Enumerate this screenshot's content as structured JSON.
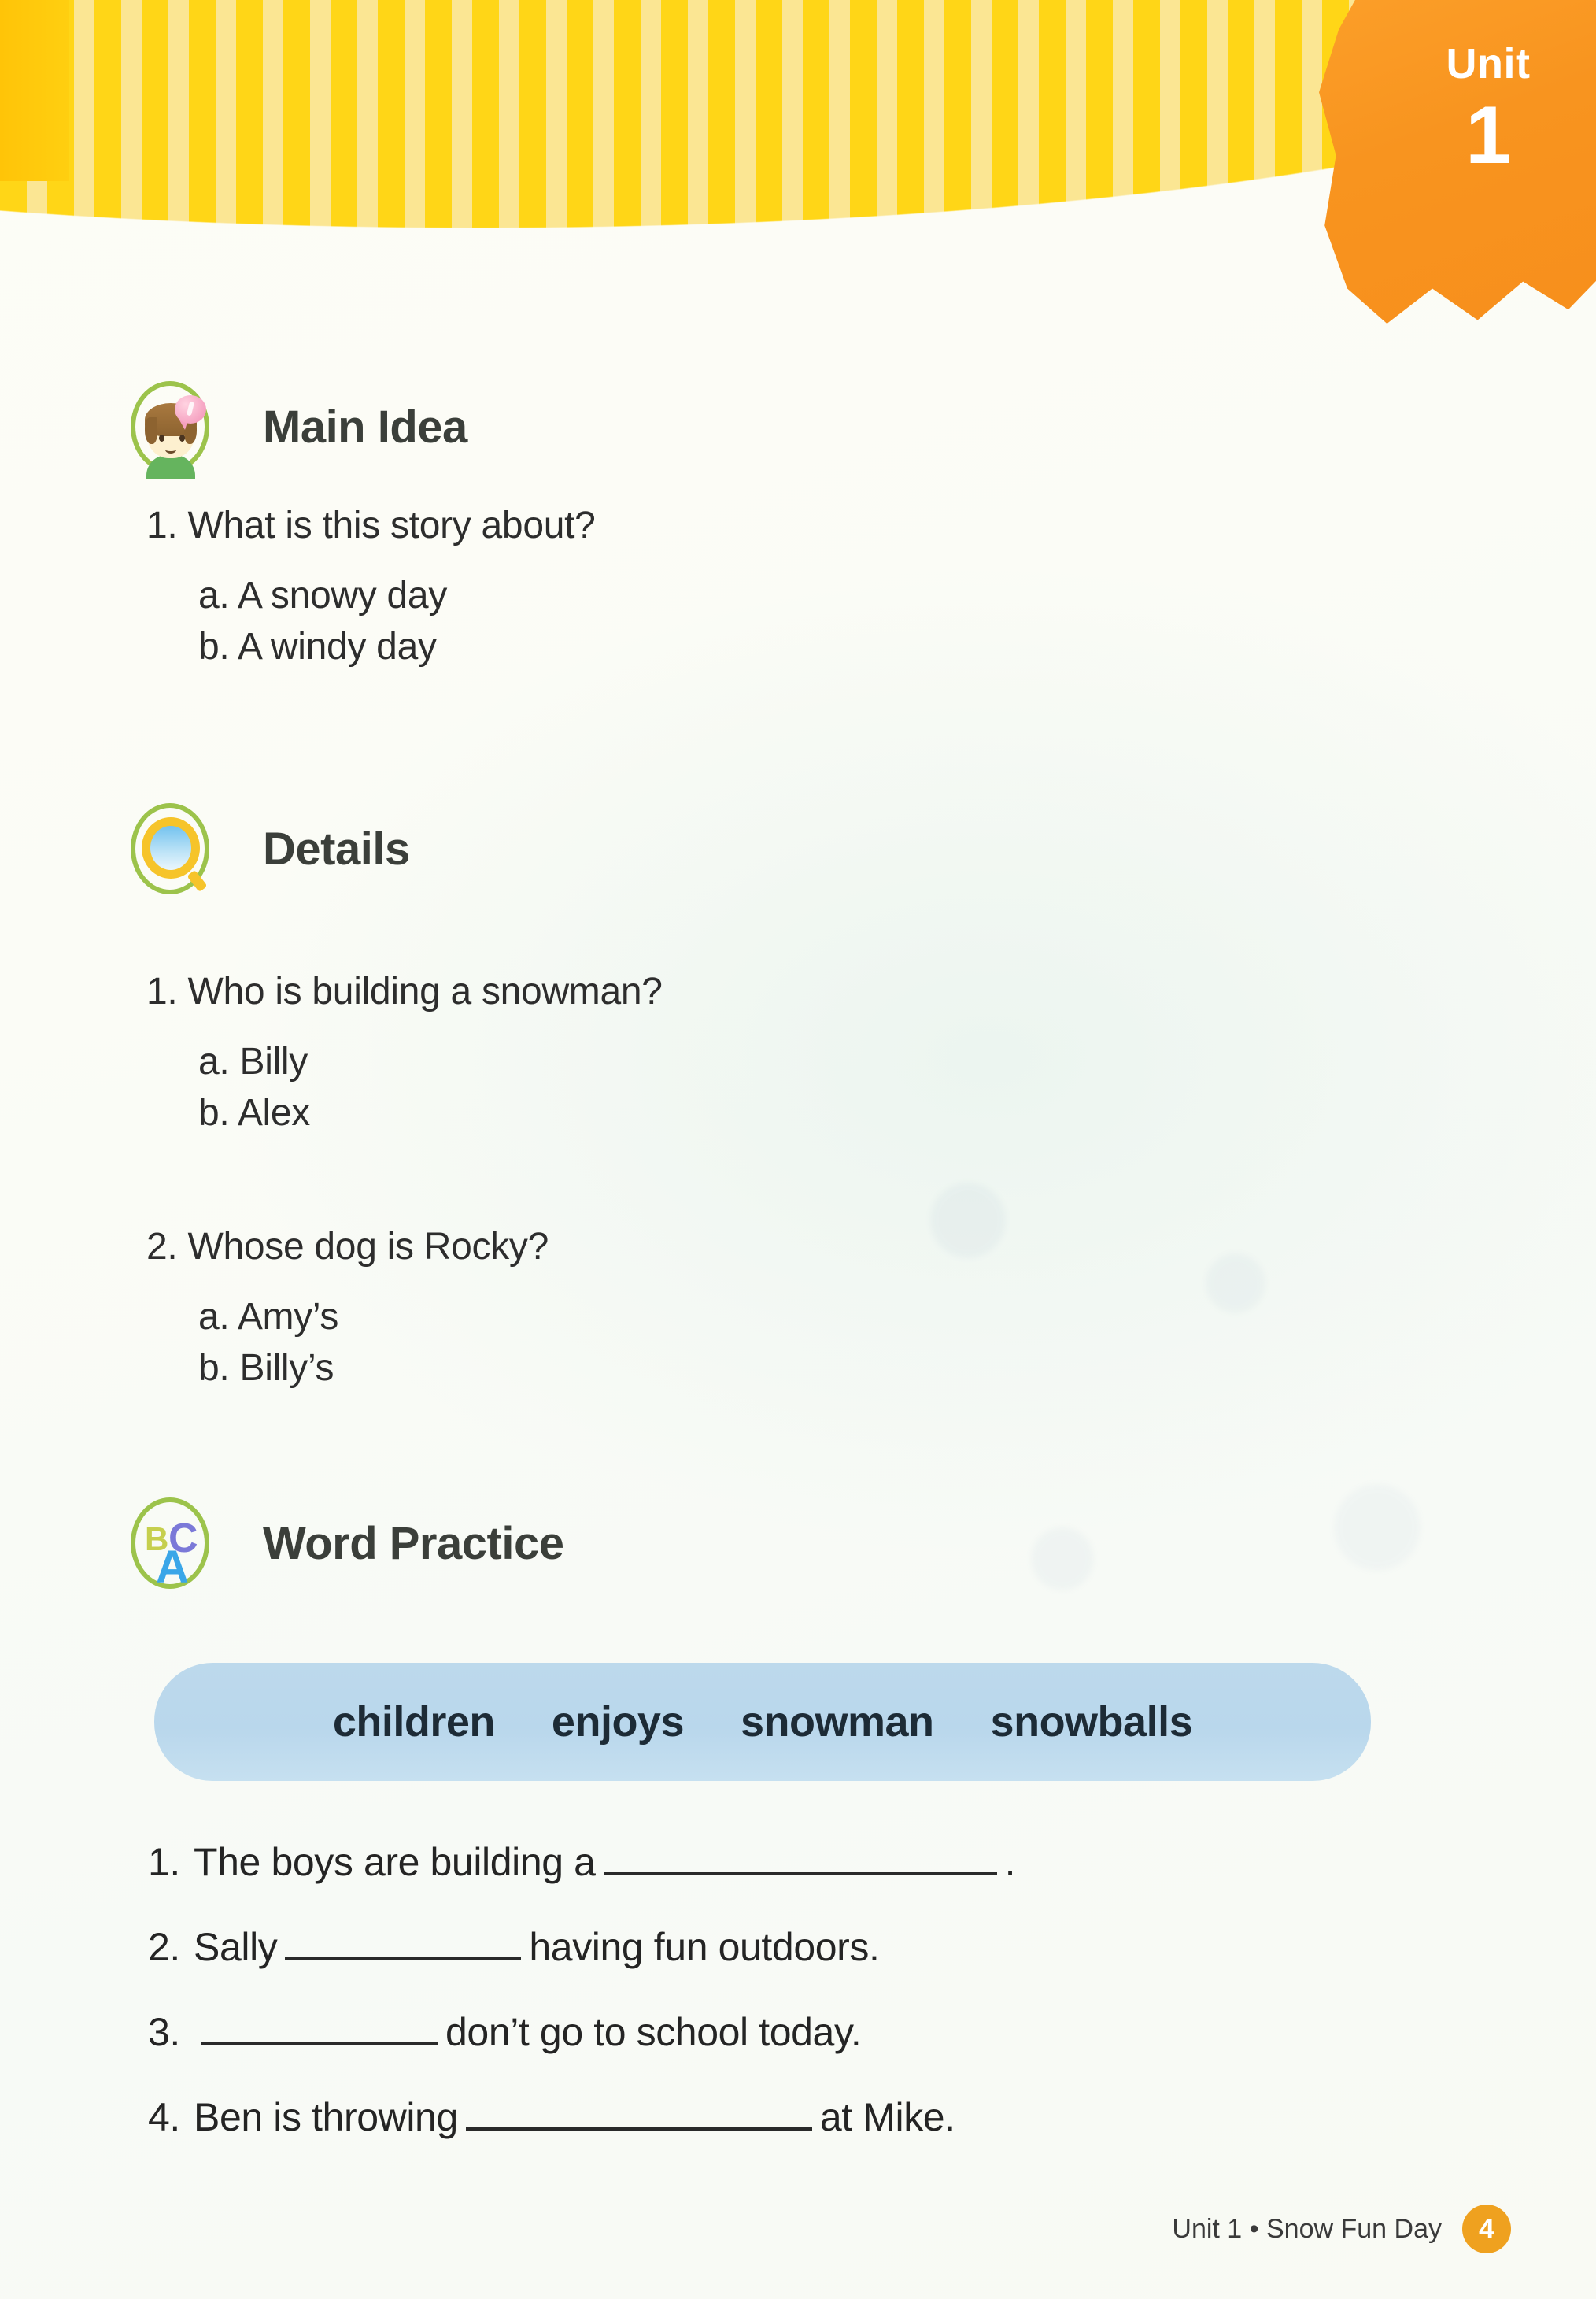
{
  "banner": {
    "unit_label": "Unit",
    "unit_number": "1",
    "stripe_color_dark": "#ffd617",
    "stripe_color_light": "#fbe693",
    "star_color": "#f8941f"
  },
  "sections": [
    {
      "id": "main-idea",
      "title": "Main Idea",
      "icon": "kid-thought-bubble-icon",
      "questions": [
        {
          "number": "1.",
          "text": "What is this story about?",
          "options": [
            {
              "letter": "a.",
              "text": "A snowy day"
            },
            {
              "letter": "b.",
              "text": "A windy day"
            }
          ]
        }
      ]
    },
    {
      "id": "details",
      "title": "Details",
      "icon": "magnifying-glass-icon",
      "questions": [
        {
          "number": "1.",
          "text": "Who is building a snowman?",
          "options": [
            {
              "letter": "a.",
              "text": "Billy"
            },
            {
              "letter": "b.",
              "text": "Alex"
            }
          ]
        },
        {
          "number": "2.",
          "text": "Whose dog is Rocky?",
          "options": [
            {
              "letter": "a.",
              "text": "Amy’s"
            },
            {
              "letter": "b.",
              "text": "Billy’s"
            }
          ]
        }
      ]
    },
    {
      "id": "word-practice",
      "title": "Word Practice",
      "icon": "abc-letters-icon"
    }
  ],
  "word_bank": {
    "background_color": "#bdd9ec",
    "words": [
      "children",
      "enjoys",
      "snowman",
      "snowballs"
    ]
  },
  "fill_in_blanks": [
    {
      "number": "1.",
      "before": "The boys are building a",
      "after": "."
    },
    {
      "number": "2.",
      "before": "Sally",
      "after": "having fun outdoors."
    },
    {
      "number": "3.",
      "before": "",
      "after": "don’t go to school today."
    },
    {
      "number": "4.",
      "before": "Ben is throwing",
      "after": "at Mike."
    }
  ],
  "footer": {
    "text": "Unit 1  •  Snow Fun Day",
    "page_number": "4",
    "badge_color": "#efa11f"
  }
}
